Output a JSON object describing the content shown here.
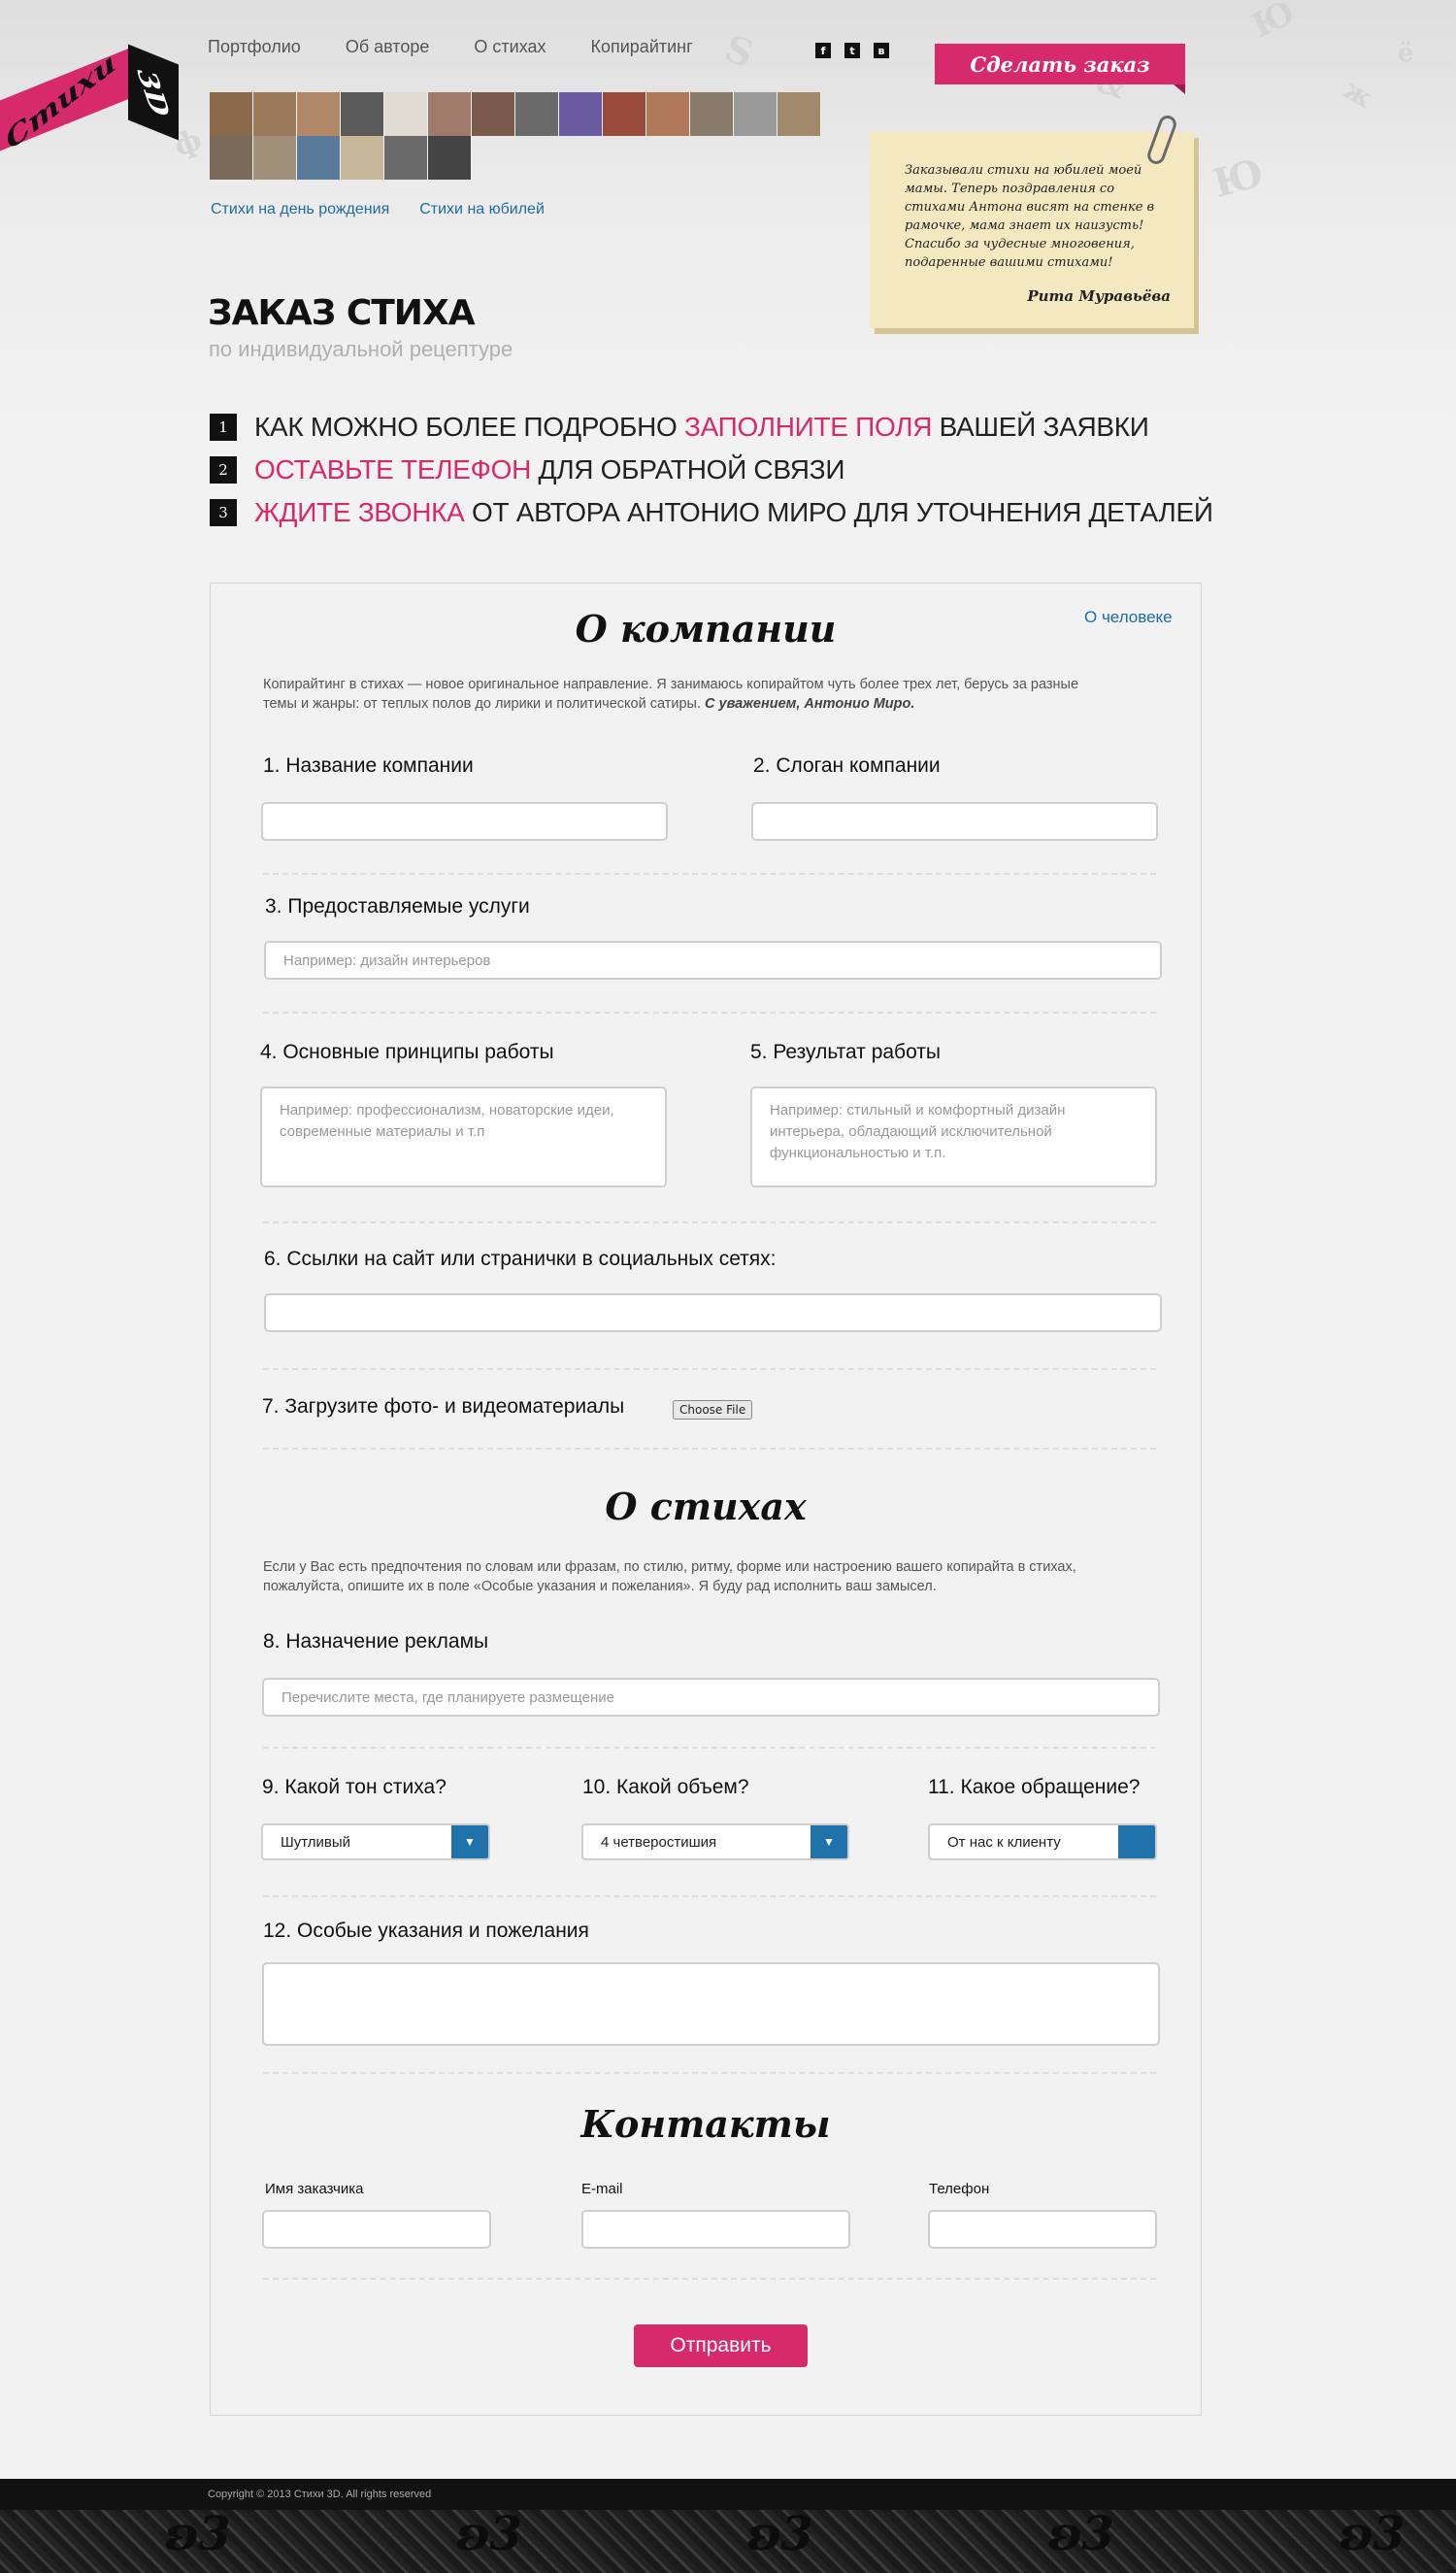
{
  "logo": {
    "word": "Стихи",
    "suffix": "3D"
  },
  "nav": [
    "Портфолио",
    "Об авторе",
    "О стихах",
    "Копирайтинг"
  ],
  "social": [
    "f",
    "t",
    "в"
  ],
  "order_button": "Сделать заказ",
  "subnav": [
    "Стихи на день рождения",
    "Стихи на юбилей"
  ],
  "testimonial": {
    "text": "Заказывали стихи на юбилей моей мамы. Теперь поздравления со стихами Антона висят на стенке в рамочке, мама знает их наизусть! Спасибо за чудесные многовения, подаренные вашими стихами!",
    "author": "Рита Муравьёва"
  },
  "title": "ЗАКАЗ СТИХА",
  "subtitle": "по индивидуальной рецептуре",
  "steps": [
    {
      "num": "1",
      "pre": "КАК МОЖНО БОЛЕЕ ПОДРОБНО ",
      "hl": "ЗАПОЛНИТЕ ПОЛЯ",
      "post": " ВАШЕЙ ЗАЯВКИ"
    },
    {
      "num": "2",
      "pre": "",
      "hl": "ОСТАВЬТЕ ТЕЛЕФОН",
      "post": " ДЛЯ ОБРАТНОЙ СВЯЗИ"
    },
    {
      "num": "3",
      "pre": "",
      "hl": "ЖДИТЕ ЗВОНКА",
      "post": " ОТ АВТОРА АНТОНИО МИРО ДЛЯ УТОЧНЕНИЯ ДЕТАЛЕЙ"
    }
  ],
  "company": {
    "title": "О компании",
    "person_link": "О человеке",
    "intro": "Копирайтинг в стихах — новое оригинальное направление. Я занимаюсь копирайтом чуть более трех лет, берусь за разные темы и жанры: от теплых полов до лирики и политической сатиры.",
    "intro_sign": "С уважением, Антонио Миро.",
    "q1": "1. Название компании",
    "q2": "2. Слоган компании",
    "q3": "3. Предоставляемые услуги",
    "q3_placeholder": "Например: дизайн интерьеров",
    "q4": "4. Основные принципы работы",
    "q4_placeholder": "Например: профессионализм, новаторские идеи, современные материалы и т.п",
    "q5": "5. Результат работы",
    "q5_placeholder": "Например: стильный и комфортный дизайн интерьера, обладающий исключительной функциональностью и т.п.",
    "q6": "6. Ссылки на сайт или странички в социальных сетях:",
    "q7": "7. Загрузите фото- и видеоматериалы",
    "file_button": "Choose File"
  },
  "poems": {
    "title": "О стихах",
    "intro": "Если у Вас есть предпочтения по словам или фразам,  по стилю, ритму, форме или настроению вашего копирайта в стихах, пожалуйста, опишите их в поле «Особые указания и пожелания». Я буду рад исполнить ваш замысел.",
    "q8": "8. Назначение рекламы",
    "q8_placeholder": "Перечислите места, где планируете размещение",
    "q9": "9. Какой тон стиха?",
    "q9_value": "Шутливый",
    "q10": "10. Какой объем?",
    "q10_value": "4 четверостишия",
    "q11": "11. Какое обращение?",
    "q11_value": "От нас к клиенту",
    "q12": "12. Особые указания и пожелания"
  },
  "contacts": {
    "title": "Контакты",
    "name_label": "Имя заказчика",
    "email_label": "E-mail",
    "phone_label": "Телефон"
  },
  "submit": "Отправить",
  "footer": {
    "copyright": "Copyright © 2013 Стихи 3D. All rights reserved"
  },
  "colors": {
    "accent": "#d62a6c",
    "link": "#1f6c9e",
    "select_arrow": "#1f73aa",
    "note": "#f4e8c0"
  },
  "icons": {
    "select_arrow": "triangle-down-icon",
    "clip": "paperclip-icon"
  }
}
